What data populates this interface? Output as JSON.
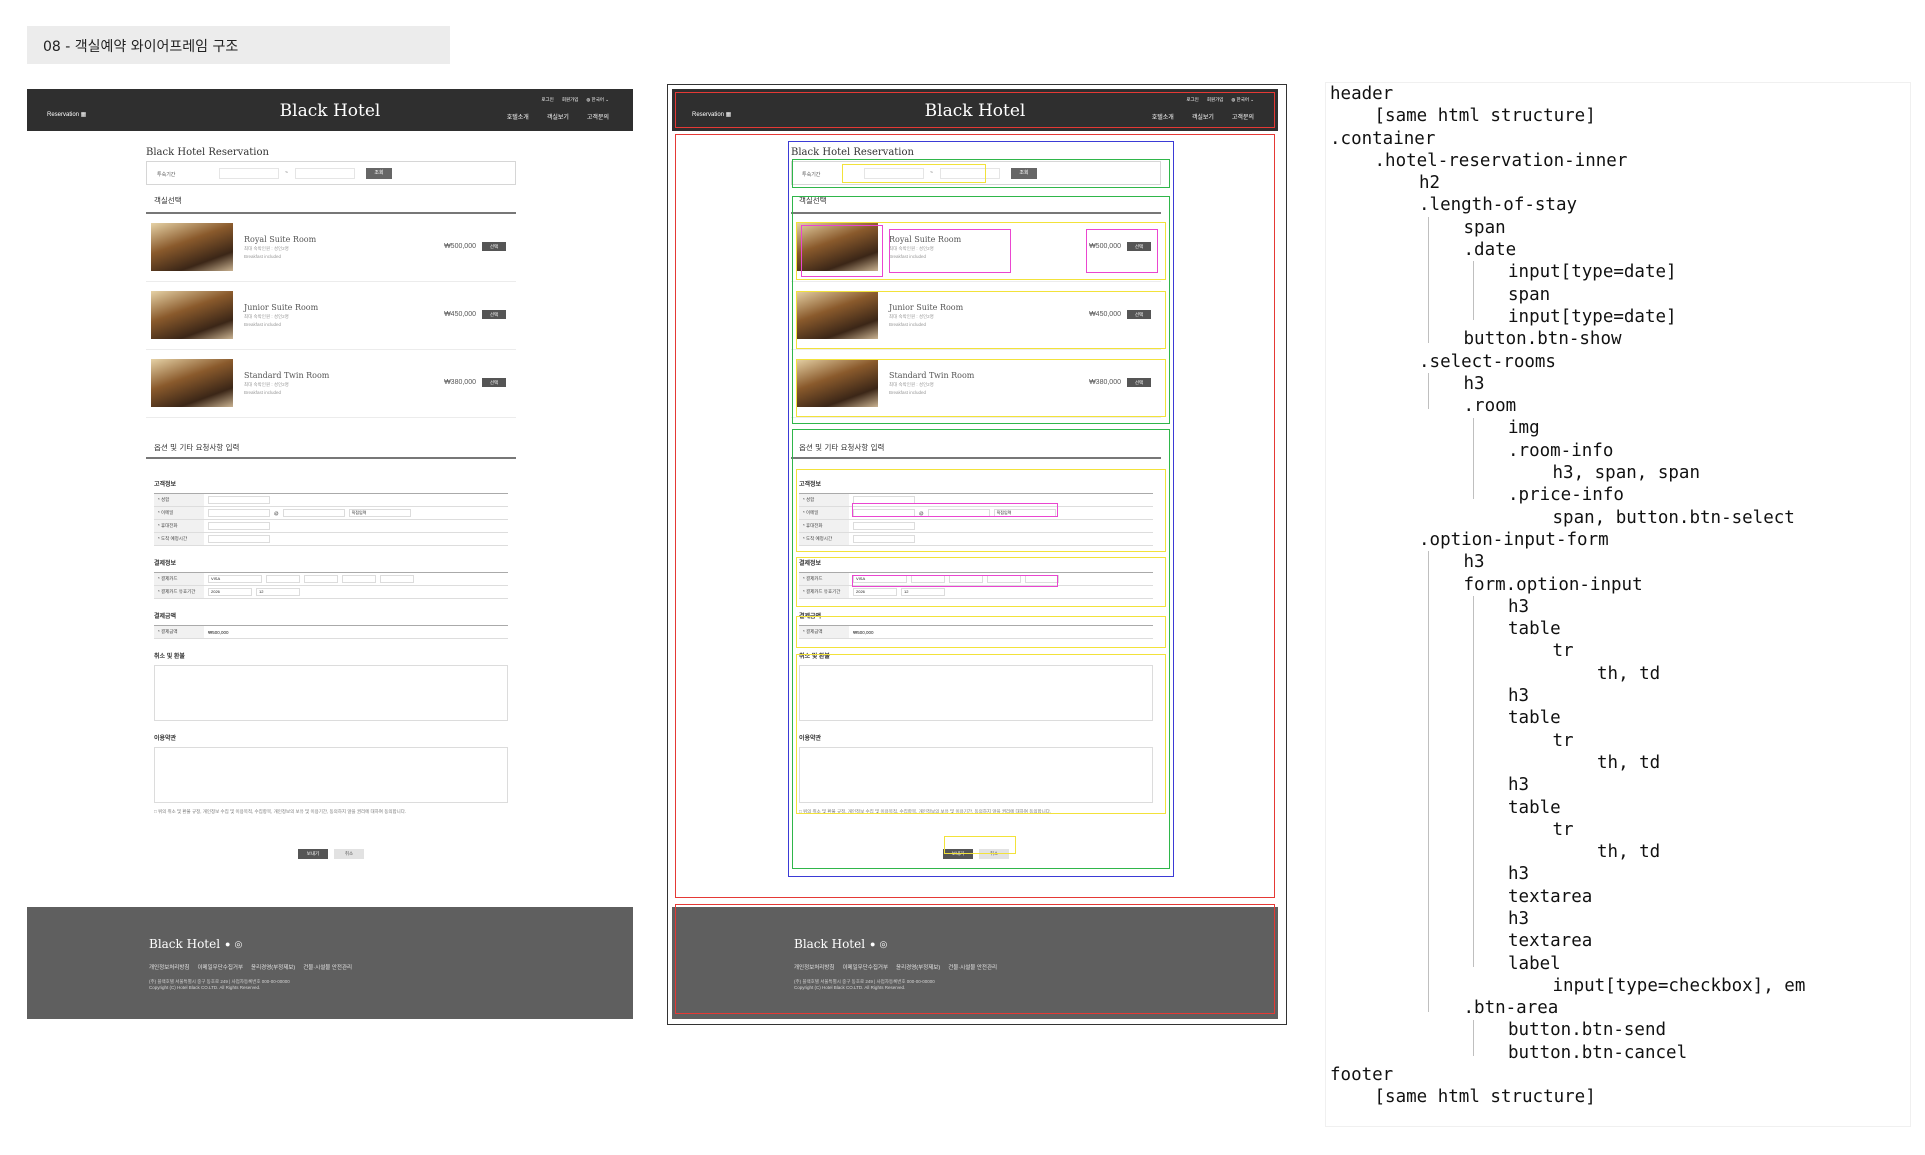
{
  "section_tag": "08 - 객실예약 와이어프레임 구조",
  "header": {
    "reservation_link": "Reservation ▦",
    "logo": "Black Hotel",
    "util_links": [
      "로그인",
      "회원가입",
      "◍ 한국어 ⌄"
    ],
    "nav": [
      "호텔소개",
      "객실보기",
      "고객문의"
    ]
  },
  "reservation": {
    "title": "Black Hotel Reservation",
    "stay_label": "투숙기간",
    "date_sep": "~",
    "show_button": "조회",
    "rooms_heading": "객실선택",
    "rooms": [
      {
        "name": "Royal Suite Room",
        "sub1": "최대 숙박인원 : 성인2명",
        "sub2": "Breakfast included",
        "price": "₩500,000",
        "select": "선택"
      },
      {
        "name": "Junior Suite Room",
        "sub1": "최대 숙박인원 : 성인2명",
        "sub2": "Breakfast included",
        "price": "₩450,000",
        "select": "선택"
      },
      {
        "name": "Standard Twin Room",
        "sub1": "최대 숙박인원 : 성인2명",
        "sub2": "Breakfast included",
        "price": "₩380,000",
        "select": "선택"
      }
    ],
    "options_heading": "옵션 및 기타 요청사항 입력",
    "customer_heading": "고객정보",
    "customer_rows": [
      "* 성함",
      "* 이메일",
      "* 휴대전화",
      "* 도착 예정시간"
    ],
    "email_at": "@",
    "email_select": "직접입력",
    "payment_heading": "결제정보",
    "payment_rows": [
      "* 결제카드",
      "* 결제카드 유효기간"
    ],
    "card_select": "VISA",
    "expiry_year": "2026",
    "expiry_month": "12",
    "amount_heading": "결제금액",
    "amount_row": "* 결제금액",
    "amount_value": "₩500,000",
    "cancel_heading": "취소 및 환불",
    "terms_heading": "이용약관",
    "agree_text": "□ 위의 취소 및 환불 규정, 개인정보 수집 및 이용목적, 수집항목, 개인정보의 보유 및 이용기간, 동의하지 않을 권리에 대하여 동의합니다.",
    "send_button": "보내기",
    "cancel_button": "취소"
  },
  "footer": {
    "logo": "Black Hotel",
    "links": [
      "개인정보처리방침",
      "이메일무단수집거부",
      "윤리경영(부정제보)",
      "건물·시설물 안전관리"
    ],
    "address": "(주) 블랙호텔 서울특별시 중구 동호로 249 | 사업자등록번호 000-00-00000",
    "copyright": "Copyright (C) Hotel Black CO.LTD. All Rights Reserved."
  },
  "code_lines": [
    {
      "indent": 0,
      "text": "header"
    },
    {
      "indent": 1,
      "text": "[same html structure]"
    },
    {
      "indent": 0,
      "text": ".container"
    },
    {
      "indent": 1,
      "text": ".hotel-reservation-inner"
    },
    {
      "indent": 2,
      "text": "h2"
    },
    {
      "indent": 2,
      "text": ".length-of-stay"
    },
    {
      "indent": 3,
      "text": "span"
    },
    {
      "indent": 3,
      "text": ".date"
    },
    {
      "indent": 4,
      "text": "input[type=date]"
    },
    {
      "indent": 4,
      "text": "span"
    },
    {
      "indent": 4,
      "text": "input[type=date]"
    },
    {
      "indent": 3,
      "text": "button.btn-show"
    },
    {
      "indent": 2,
      "text": ".select-rooms"
    },
    {
      "indent": 3,
      "text": "h3"
    },
    {
      "indent": 3,
      "text": ".room"
    },
    {
      "indent": 4,
      "text": "img"
    },
    {
      "indent": 4,
      "text": ".room-info"
    },
    {
      "indent": 5,
      "text": "h3, span, span"
    },
    {
      "indent": 4,
      "text": ".price-info"
    },
    {
      "indent": 5,
      "text": "span, button.btn-select"
    },
    {
      "indent": 2,
      "text": ".option-input-form"
    },
    {
      "indent": 3,
      "text": "h3"
    },
    {
      "indent": 3,
      "text": "form.option-input"
    },
    {
      "indent": 4,
      "text": "h3"
    },
    {
      "indent": 4,
      "text": "table"
    },
    {
      "indent": 5,
      "text": "tr"
    },
    {
      "indent": 6,
      "text": "th, td"
    },
    {
      "indent": 4,
      "text": "h3"
    },
    {
      "indent": 4,
      "text": "table"
    },
    {
      "indent": 5,
      "text": "tr"
    },
    {
      "indent": 6,
      "text": "th, td"
    },
    {
      "indent": 4,
      "text": "h3"
    },
    {
      "indent": 4,
      "text": "table"
    },
    {
      "indent": 5,
      "text": "tr"
    },
    {
      "indent": 6,
      "text": "th, td"
    },
    {
      "indent": 4,
      "text": "h3"
    },
    {
      "indent": 4,
      "text": "textarea"
    },
    {
      "indent": 4,
      "text": "h3"
    },
    {
      "indent": 4,
      "text": "textarea"
    },
    {
      "indent": 4,
      "text": "label"
    },
    {
      "indent": 5,
      "text": "input[type=checkbox], em"
    },
    {
      "indent": 3,
      "text": ".btn-area"
    },
    {
      "indent": 4,
      "text": "button.btn-send"
    },
    {
      "indent": 4,
      "text": "button.btn-cancel"
    },
    {
      "indent": 0,
      "text": "footer"
    },
    {
      "indent": 1,
      "text": "[same html structure]"
    }
  ],
  "colors": {
    "header_bg": "#2f2f2f",
    "footer_bg": "#5f5f5f",
    "outline_red": "#e53935",
    "outline_blue": "#3b3bd6",
    "outline_green": "#2fb64a",
    "outline_yellow": "#f2e23a",
    "outline_pink": "#ea46d0"
  }
}
